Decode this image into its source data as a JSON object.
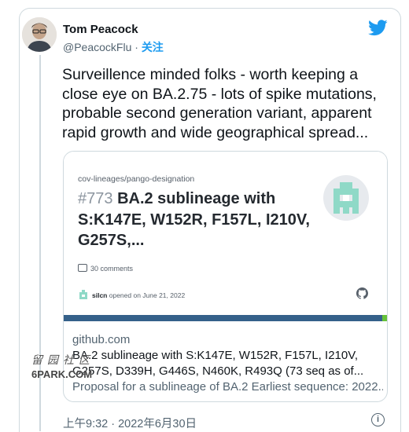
{
  "author": {
    "name": "Tom Peacock",
    "handle": "@PeacockFlu",
    "separator": " · ",
    "follow_label": "关注"
  },
  "icons": {
    "brand": "twitter-bird-icon",
    "info": "info-icon",
    "github": "github-icon",
    "comments": "comment-icon"
  },
  "colors": {
    "brand": "#1d9bf0",
    "card_bar": "#35618a",
    "card_bar_end": "#67c23a",
    "logo": "#8fd9c7"
  },
  "tweet": {
    "text": "Surveillence minded folks - worth keeping a close eye on BA.2.75 - lots of spike mutations, probable second generation variant, apparent rapid growth and wide geographical spread..."
  },
  "card": {
    "image": {
      "repo_path": "cov-lineages/pango-designation",
      "number": "#773",
      "title": "BA.2 sublineage with S:K147E, W152R, F157L, I210V, G257S,...",
      "comments": "30 comments",
      "author": "silcn",
      "opened": "opened on June 21, 2022"
    },
    "domain": "github.com",
    "title": "BA.2 sublineage with S:K147E, W152R, F157L, I210V, G257S, D339H, G446S, N460K, R493Q (73 seq as of...",
    "description": "Proposal for a sublineage of BA.2 Earliest sequence: 2022..."
  },
  "timestamp": "上午9:32 · 2022年6月30日",
  "watermark": {
    "line1": "留园社区",
    "line2": "6PARK.COM"
  }
}
